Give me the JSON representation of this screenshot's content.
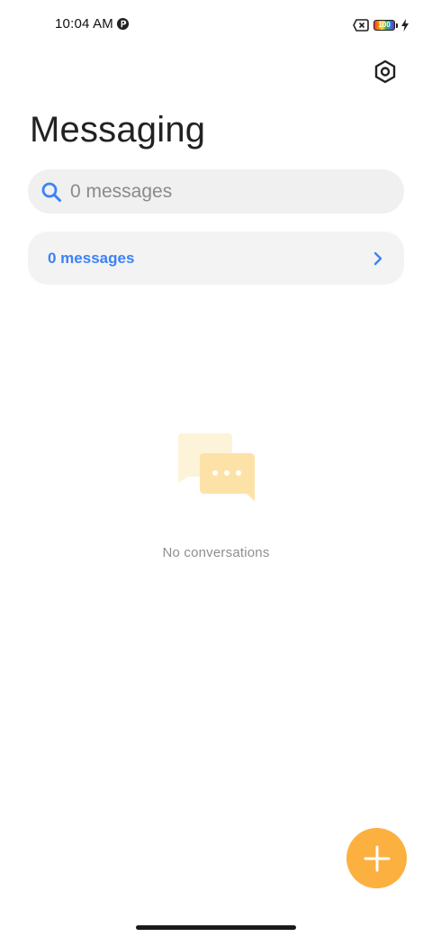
{
  "status_bar": {
    "time": "10:04 AM",
    "battery_level": "100",
    "icons": [
      "app-indicator-icon",
      "no-sim-icon",
      "battery-icon",
      "charging-bolt-icon"
    ]
  },
  "header": {
    "title": "Messaging",
    "settings_icon": "gear-icon"
  },
  "search": {
    "placeholder": "0 messages",
    "icon": "search-icon"
  },
  "messages_row": {
    "label": "0 messages",
    "icon": "chevron-right-icon"
  },
  "empty_state": {
    "text": "No conversations",
    "icon": "chat-bubbles-icon"
  },
  "fab": {
    "icon": "plus-icon"
  },
  "colors": {
    "accent_blue": "#3b82f6",
    "fab_orange": "#fbb040",
    "surface_gray": "#f0f0f1",
    "illustration_yellow_light": "#fdf3d8",
    "illustration_yellow": "#fde2a8"
  }
}
